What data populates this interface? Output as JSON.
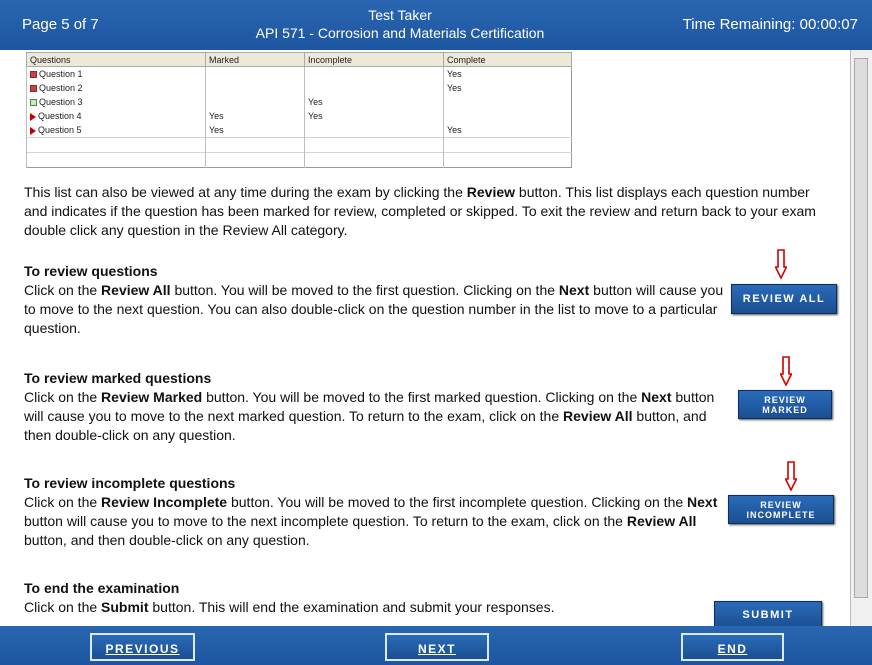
{
  "header": {
    "page_indicator": "Page 5 of 7",
    "candidate": "Test Taker",
    "exam_title": "API 571 - Corrosion and Materials Certification",
    "time_remaining": "Time Remaining: 00:00:07",
    "bar_color": "#1f5aa6"
  },
  "review_table": {
    "columns": [
      "Questions",
      "Marked",
      "Incomplete",
      "Complete"
    ],
    "rows": [
      {
        "question": "Question 1",
        "marked": "",
        "incomplete": "",
        "complete": "Yes",
        "icon": "answered-icon"
      },
      {
        "question": "Question 2",
        "marked": "",
        "incomplete": "",
        "complete": "Yes",
        "icon": "answered-icon"
      },
      {
        "question": "Question 3",
        "marked": "",
        "incomplete": "Yes",
        "complete": "",
        "icon": "incomplete-icon"
      },
      {
        "question": "Question 4",
        "marked": "Yes",
        "incomplete": "Yes",
        "complete": "",
        "icon": "marked-flag-icon"
      },
      {
        "question": "Question 5",
        "marked": "Yes",
        "incomplete": "",
        "complete": "Yes",
        "icon": "marked-flag-icon"
      }
    ]
  },
  "intro": {
    "t1": "This list can also be viewed at any time during the exam by clicking the ",
    "b1": "Review",
    "t2": " button. This list displays each question number and indicates if the question has been marked for review, completed or skipped. To exit the review and return back to your exam double click any question in the Review All category."
  },
  "sections": {
    "review_all": {
      "heading": "To review questions",
      "t1": "Click on the ",
      "b1": "Review All",
      "t2": " button. You will be moved to the first question. Clicking on the ",
      "b2": "Next",
      "t3": " button will cause you to move to the next question. You can also double-click on the question number in the list to move to a particular question.",
      "button": "Review All"
    },
    "review_marked": {
      "heading": "To review marked questions",
      "t1": "Click on the ",
      "b1": "Review Marked",
      "t2": " button. You will be moved to the first marked question. Clicking on the ",
      "b2": "Next",
      "t3": " button will cause you to move to the next marked question. To return to the exam, click on the ",
      "b3": "Review All",
      "t4": " button, and then double-click on any question.",
      "button_line1": "Review",
      "button_line2": "Marked"
    },
    "review_incomplete": {
      "heading": "To review incomplete questions",
      "t1": "Click on the ",
      "b1": "Review Incomplete",
      "t2": " button. You will be moved to the first incomplete question. Clicking on the ",
      "b2": "Next",
      "t3": " button will cause you to move to the next incomplete question. To return to the exam, click on the ",
      "b3": "Review All",
      "t4": " button, and then double-click on any question.",
      "button_line1": "Review",
      "button_line2": "Incomplete"
    },
    "end_exam": {
      "heading": "To end the examination",
      "t1": "Click on the ",
      "b1": "Submit",
      "t2": " button. This will end the examination and submit your responses.",
      "button": "Submit"
    }
  },
  "footer": {
    "previous": "Previous",
    "next": "Next",
    "end": "End"
  },
  "colors": {
    "button_blue": "#1f5aa6",
    "annotation_arrow": "#d10000"
  }
}
